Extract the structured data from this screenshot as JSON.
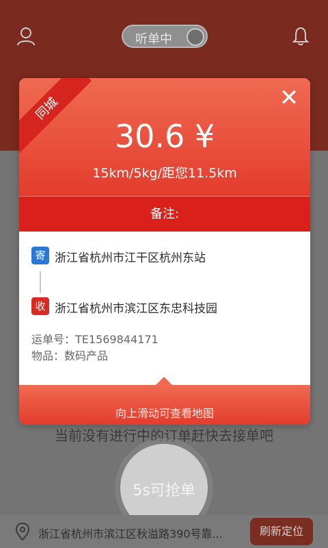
{
  "header": {
    "toggle_label": "听单中"
  },
  "background": {
    "empty_message": "当前没有进行中的订单赶快去接单吧",
    "grab_button": "5s可抢单",
    "location_text": "浙江省杭州市滨江区秋溢路390号靠...",
    "refresh_button": "刷新定位"
  },
  "order": {
    "ribbon": "同城",
    "price": "30.6 ¥",
    "meta": "15km/5kg/距您11.5km",
    "note_label": "备注:",
    "sender_tag": "寄",
    "sender_address": "浙江省杭州市江干区杭州东站",
    "receiver_tag": "收",
    "receiver_address": "浙江省杭州市滨江区东忠科技园",
    "waybill": "运单号：TE1569844171",
    "goods": "物品：数码产品",
    "swipe_hint": "向上滑动可查看地图"
  },
  "colors": {
    "accent": "#e33c2d",
    "send_blue": "#2a77d6",
    "receive_red": "#d92b25"
  },
  "icons": [
    "user-icon",
    "bell-icon",
    "close-icon",
    "location-pin-icon"
  ]
}
